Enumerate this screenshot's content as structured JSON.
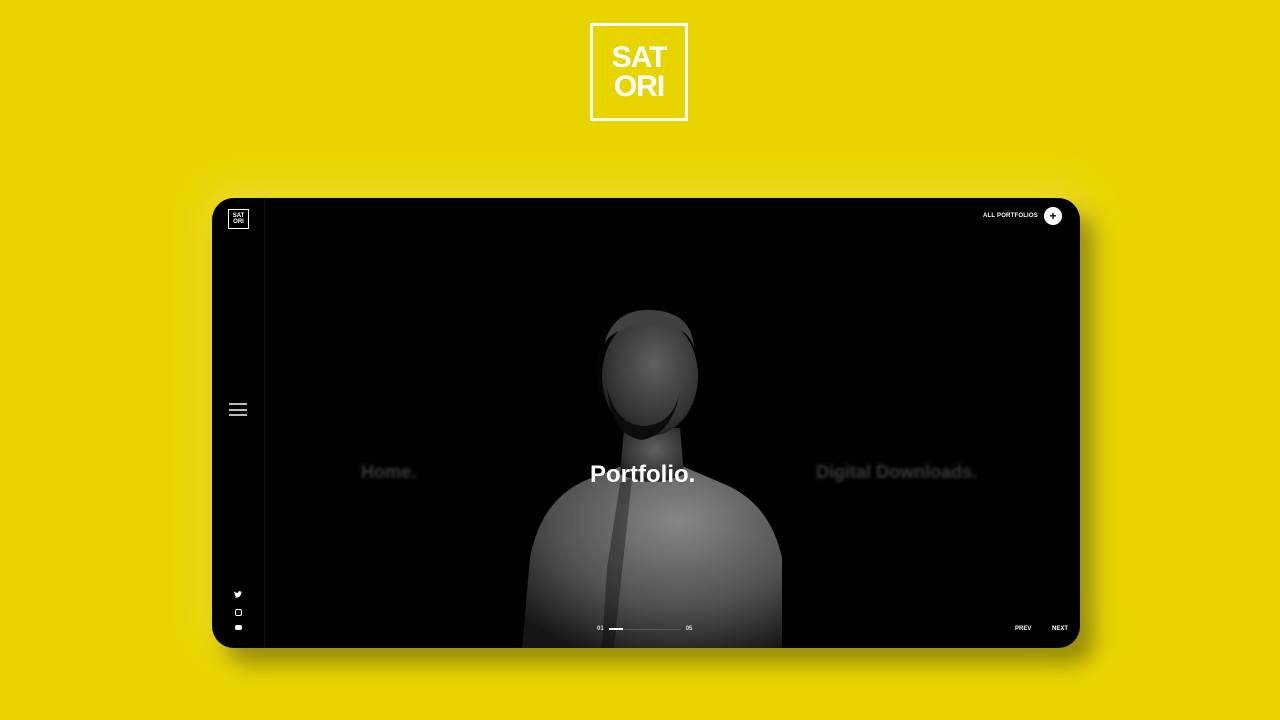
{
  "brand": {
    "logo_line1": "SAT",
    "logo_line2": "ORI"
  },
  "window": {
    "logo_line1": "SAT",
    "logo_line2": "ORI",
    "all_portfolios_label": "ALL PORTFOLIOS",
    "plus_symbol": "+"
  },
  "sidebar": {
    "menu_icon": "hamburger-menu-icon",
    "social_icons": [
      "twitter-icon",
      "instagram-icon",
      "youtube-icon"
    ]
  },
  "slides": {
    "prev_title": "Home.",
    "current_title": "Portfolio.",
    "next_title": "Digital Downloads."
  },
  "pager": {
    "current": "01",
    "total": "05",
    "progress": 0.2
  },
  "nav": {
    "prev": "PREV",
    "next": "NEXT"
  },
  "colors": {
    "background": "#E8D500",
    "window": "#000000",
    "text": "#FFFFFF"
  }
}
